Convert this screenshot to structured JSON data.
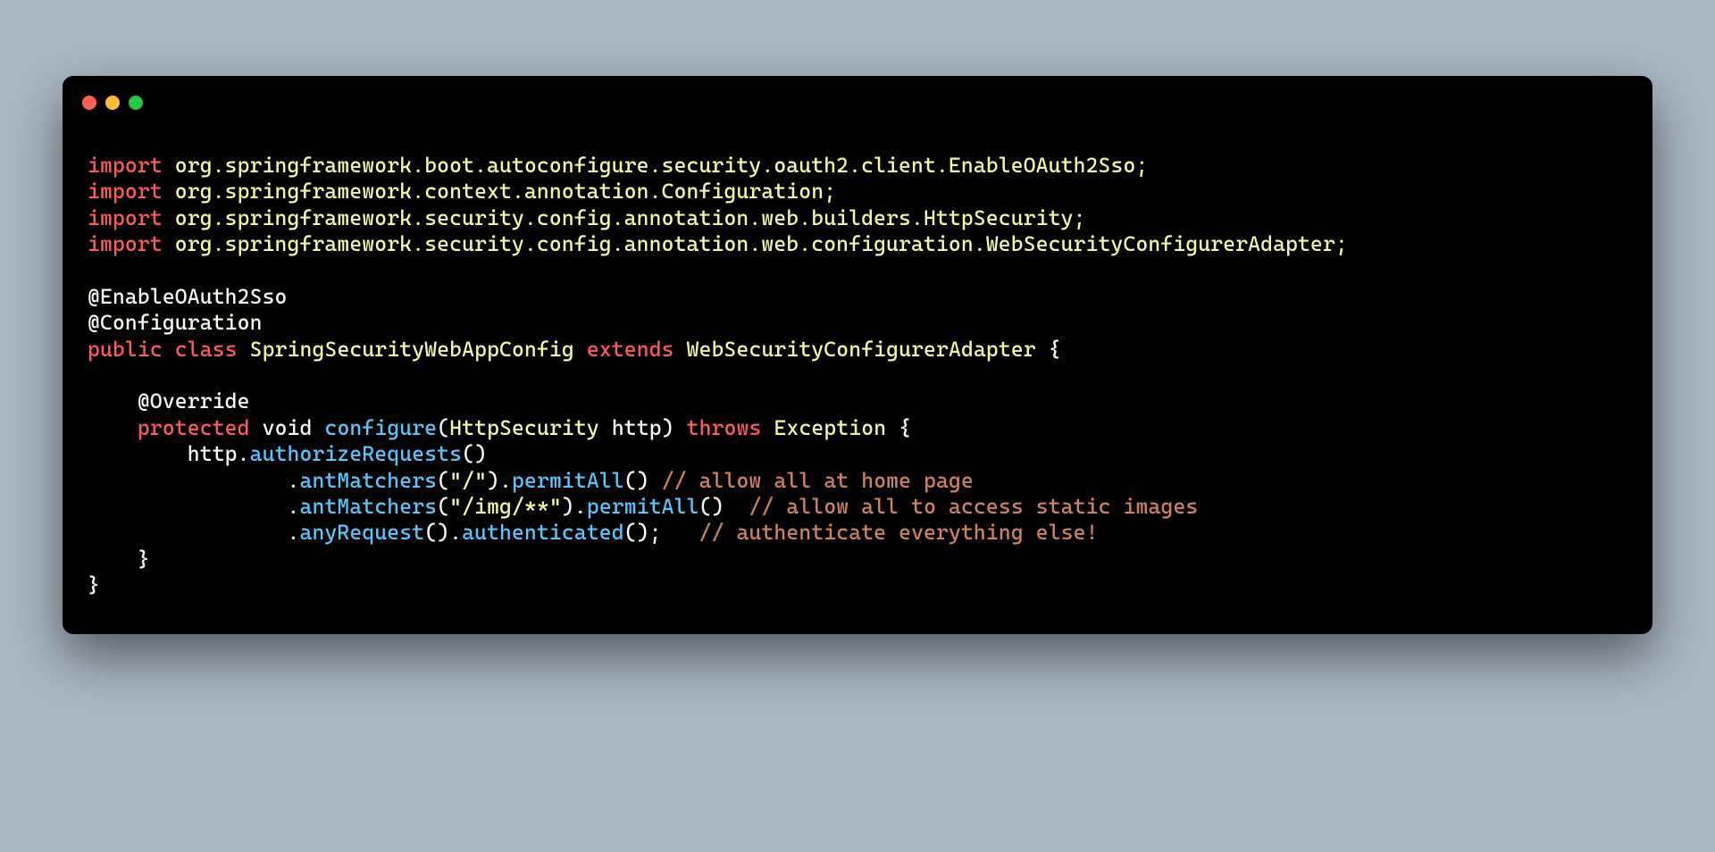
{
  "code": {
    "line1": {
      "kw": "import",
      "pkg": " org.springframework.boot.autoconfigure.security.oauth2.client.EnableOAuth2Sso;"
    },
    "line2": {
      "kw": "import",
      "pkg": " org.springframework.context.annotation.Configuration;"
    },
    "line3": {
      "kw": "import",
      "pkg": " org.springframework.security.config.annotation.web.builders.HttpSecurity;"
    },
    "line4": {
      "kw": "import",
      "pkg": " org.springframework.security.config.annotation.web.configuration.WebSecurityConfigurerAdapter;"
    },
    "line6": {
      "anno": "@EnableOAuth2Sso"
    },
    "line7": {
      "anno": "@Configuration"
    },
    "line8": {
      "kw_public": "public",
      "sp1": " ",
      "kw_class": "class",
      "sp2": " ",
      "classname": "SpringSecurityWebAppConfig",
      "sp3": " ",
      "kw_extends": "extends",
      "sp4": " ",
      "supertype": "WebSecurityConfigurerAdapter",
      "brace": " {"
    },
    "line10": {
      "indent": "    ",
      "anno": "@Override"
    },
    "line11": {
      "indent": "    ",
      "kw_protected": "protected",
      "sp1": " ",
      "void": "void",
      "sp2": " ",
      "method": "configure",
      "paren_open": "(",
      "paramtype": "HttpSecurity",
      "sp3": " ",
      "paramname": "http",
      "paren_close": ")",
      "sp4": " ",
      "kw_throws": "throws",
      "sp5": " ",
      "exctype": "Exception",
      "brace": " {"
    },
    "line12": {
      "indent": "        ",
      "obj": "http",
      "dot": ".",
      "method": "authorizeRequests",
      "parens": "()"
    },
    "line13": {
      "indent": "                ",
      "dot1": ".",
      "method1": "antMatchers",
      "p1": "(",
      "str1": "\"/\"",
      "p2": ")",
      "dot2": ".",
      "method2": "permitAll",
      "parens2": "()",
      "sp": " ",
      "comment": "// allow all at home page"
    },
    "line14": {
      "indent": "                ",
      "dot1": ".",
      "method1": "antMatchers",
      "p1": "(",
      "str1": "\"/img/**\"",
      "p2": ")",
      "dot2": ".",
      "method2": "permitAll",
      "parens2": "()",
      "sp": "  ",
      "comment": "// allow all to access static images"
    },
    "line15": {
      "indent": "                ",
      "dot1": ".",
      "method1": "anyRequest",
      "parens1": "()",
      "dot2": ".",
      "method2": "authenticated",
      "parens2": "();",
      "sp": "   ",
      "comment": "// authenticate everything else!"
    },
    "line16": {
      "indent": "    ",
      "brace": "}"
    },
    "line17": {
      "brace": "}"
    }
  }
}
